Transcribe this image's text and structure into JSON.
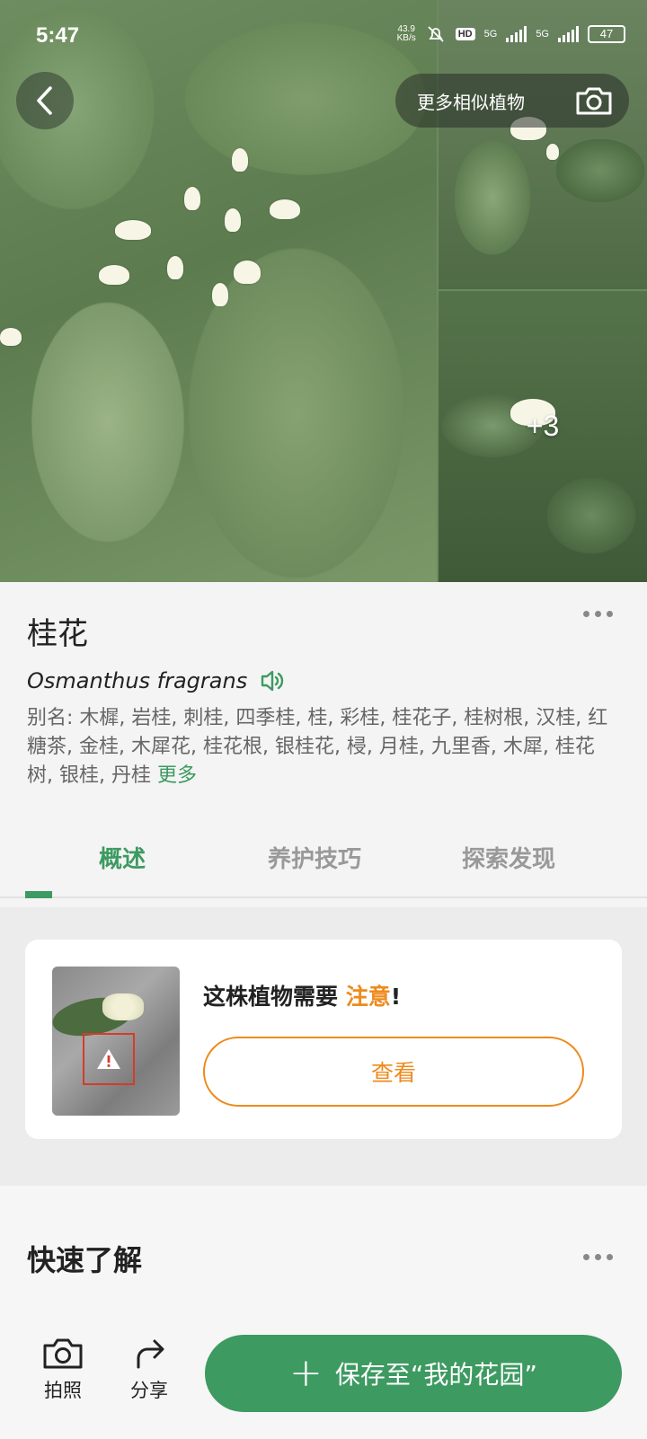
{
  "status_bar": {
    "time": "5:47",
    "net_speed_value": "43.9",
    "net_speed_unit": "KB/s",
    "hd_label": "HD",
    "signal1_label": "5G",
    "signal2_label": "5G",
    "battery": "47"
  },
  "hero": {
    "similar_label": "更多相似植物",
    "extra_photos_label": "+3"
  },
  "plant": {
    "name": "桂花",
    "latin": "Osmanthus fragrans",
    "alias_text": "别名: 木樨, 岩桂, 刺桂, 四季桂, 桂, 彩桂, 桂花子, 桂树根, 汉桂, 红糖茶, 金桂, 木犀花, 桂花根, 银桂花, 梫, 月桂, 九里香, 木犀, 桂花树, 银桂, 丹桂",
    "alias_more": "更多"
  },
  "tabs": [
    {
      "label": "概述",
      "active": true
    },
    {
      "label": "养护技巧",
      "active": false
    },
    {
      "label": "探索发现",
      "active": false
    }
  ],
  "attention": {
    "title_prefix": "这株植物需要 ",
    "title_highlight": "注意",
    "title_suffix": "!",
    "button": "查看"
  },
  "quick": {
    "title": "快速了解"
  },
  "bottom_bar": {
    "photo_label": "拍照",
    "share_label": "分享",
    "save_label": "保存至“我的花园”"
  },
  "colors": {
    "accent_green": "#3d9a61",
    "warning_orange": "#ee8a1c"
  }
}
